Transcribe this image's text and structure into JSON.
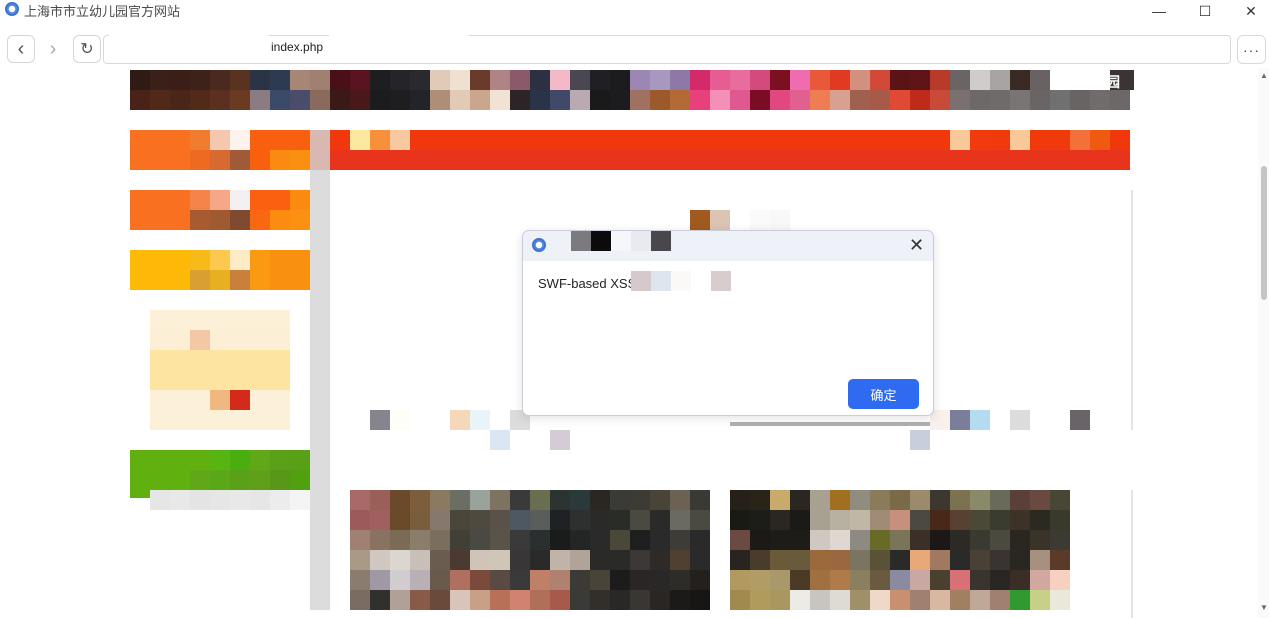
{
  "window": {
    "title": "上海市市立幼儿园官方网站",
    "minimize_glyph": "—",
    "maximize_glyph": "☐",
    "close_glyph": "✕"
  },
  "toolbar": {
    "back_glyph": "‹",
    "forward_glyph": "›",
    "reload_glyph": "↻",
    "url": "index.php",
    "menu_glyph": "···"
  },
  "page": {
    "corner_text": "儿园"
  },
  "dialog": {
    "close_glyph": "✕",
    "message": "SWF-based XSS",
    "ok_label": "确定"
  },
  "colors": {
    "accent": "#2e6bf0",
    "banner_red": "#e8341c"
  },
  "icons": {
    "app": "browser-logo-icon",
    "back": "chevron-left-icon",
    "forward": "chevron-right-icon",
    "reload": "reload-icon",
    "menu": "more-icon",
    "dialog_close": "close-icon"
  }
}
